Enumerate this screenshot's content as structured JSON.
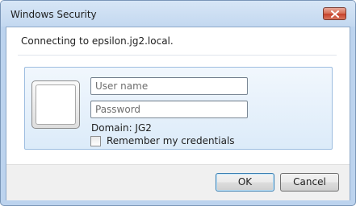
{
  "window": {
    "title": "Windows Security"
  },
  "dialog": {
    "connecting_text": "Connecting to epsilon.jg2.local.",
    "username_placeholder": "User name",
    "password_placeholder": "Password",
    "domain_text": "Domain: JG2",
    "remember_label": "Remember my credentials",
    "remember_checked": false
  },
  "buttons": {
    "ok_label": "OK",
    "cancel_label": "Cancel"
  },
  "icons": {
    "close": "close-icon",
    "user_tile": "user-tile-icon"
  },
  "colors": {
    "title_bar": "#c9ddf3",
    "close_button": "#c6412a",
    "panel": "#dcebf9"
  }
}
